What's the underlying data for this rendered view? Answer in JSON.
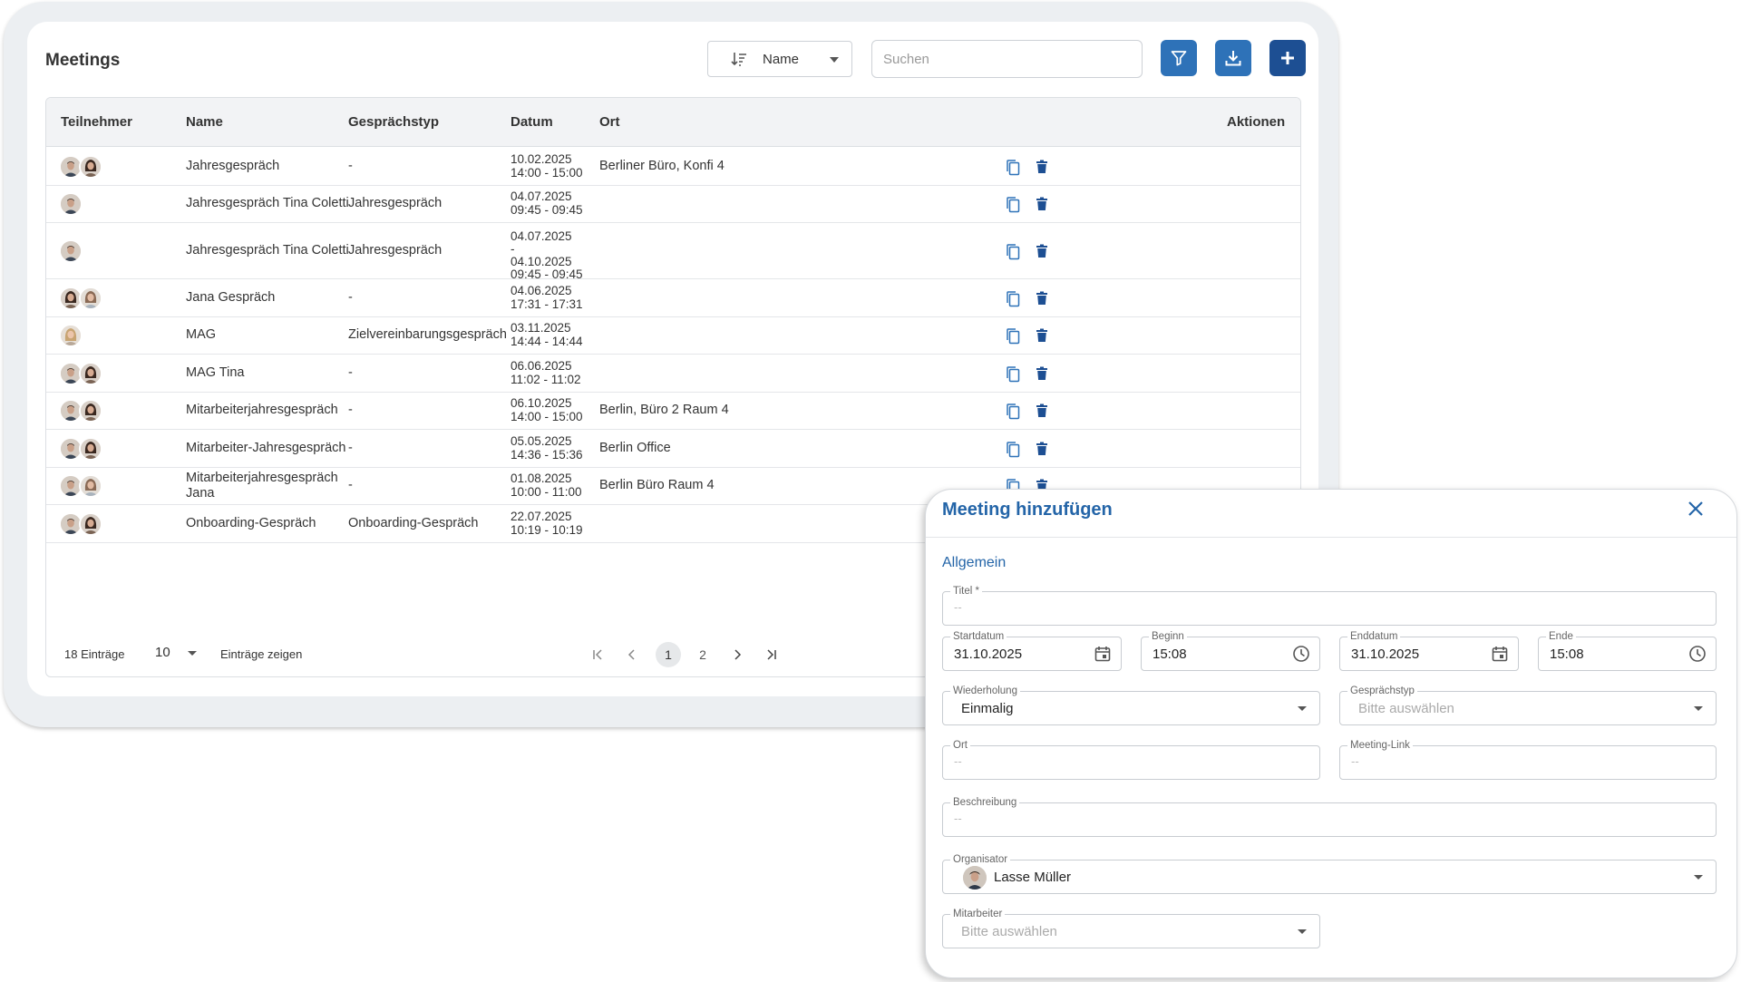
{
  "meetings": {
    "title": "Meetings",
    "sort": {
      "label": "Name",
      "icon": "sort-ascending-icon"
    },
    "search": {
      "placeholder": "Suchen",
      "value": ""
    },
    "toolbar": {
      "filter_icon": "filter-icon",
      "download_icon": "download-icon",
      "add_icon": "plus-icon"
    },
    "colors": {
      "primary": "#2e72b8",
      "primary_dark": "#1d4f93",
      "header_bg": "#f2f3f5"
    },
    "columns": {
      "participants": "Teilnehmer",
      "name": "Name",
      "type": "Gesprächstyp",
      "date": "Datum",
      "location": "Ort",
      "actions": "Aktionen"
    },
    "rows": [
      {
        "participants": [
          "man",
          "woman-dark"
        ],
        "name": "Jahresgespräch",
        "type": "-",
        "date": "10.02.2025",
        "time": "14:00 - 15:00",
        "location": "Berliner Büro, Konfi 4"
      },
      {
        "participants": [
          "man"
        ],
        "name": "Jahresgespräch Tina Coletti",
        "type": "Jahresgespräch",
        "date": "04.07.2025",
        "time": "09:45 - 09:45",
        "location": ""
      },
      {
        "participants": [
          "man"
        ],
        "name": "Jahresgespräch Tina Coletti",
        "type": "Jahresgespräch",
        "date": "04.07.2025",
        "date_sep": "-",
        "date_end": "04.10.2025",
        "time": "09:45 - 09:45",
        "location": ""
      },
      {
        "participants": [
          "woman-dark",
          "woman-light"
        ],
        "name": "Jana Gespräch",
        "type": "-",
        "date": "04.06.2025",
        "time": "17:31 - 17:31",
        "location": ""
      },
      {
        "participants": [
          "woman-blonde"
        ],
        "name": "MAG",
        "type": "Zielvereinbarungsgespräch",
        "date": "03.11.2025",
        "time": "14:44 - 14:44",
        "location": ""
      },
      {
        "participants": [
          "man",
          "woman-dark"
        ],
        "name": "MAG Tina",
        "type": "-",
        "date": "06.06.2025",
        "time": "11:02 - 11:02",
        "location": ""
      },
      {
        "participants": [
          "man",
          "woman-dark"
        ],
        "name": "Mitarbeiterjahresgespräch",
        "type": "-",
        "date": "06.10.2025",
        "time": "14:00 - 15:00",
        "location": "Berlin, Büro 2 Raum 4"
      },
      {
        "participants": [
          "man",
          "woman-dark"
        ],
        "name": "Mitarbeiter-Jahresgespräch",
        "type": "-",
        "date": "05.05.2025",
        "time": "14:36 - 15:36",
        "location": "Berlin Office"
      },
      {
        "participants": [
          "man",
          "woman-light"
        ],
        "name": "Mitarbeiterjahresgespräch",
        "name2": "Jana",
        "type": "-",
        "date": "01.08.2025",
        "time": "10:00 - 11:00",
        "location": "Berlin Büro Raum 4"
      },
      {
        "participants": [
          "man",
          "woman-dark"
        ],
        "name": "Onboarding-Gespräch",
        "type": "Onboarding-Gespräch",
        "date": "22.07.2025",
        "time": "10:19 - 10:19",
        "location": ""
      }
    ],
    "footer": {
      "total": "18 Einträge",
      "page_size": "10",
      "page_size_label": "Einträge zeigen",
      "pages": [
        "1",
        "2"
      ],
      "current_page": "1",
      "first_icon": "first-page-icon",
      "prev_icon": "chevron-left-icon",
      "next_icon": "chevron-right-icon",
      "last_icon": "last-page-icon"
    }
  },
  "modal": {
    "title": "Meeting hinzufügen",
    "close_icon": "close-icon",
    "tab": "Allgemein",
    "fields": {
      "title": {
        "label": "Titel *",
        "placeholder": "--"
      },
      "start_date": {
        "label": "Startdatum",
        "value": "31.10.2025",
        "icon": "calendar-icon"
      },
      "start_time": {
        "label": "Beginn",
        "value": "15:08",
        "icon": "clock-icon"
      },
      "end_date": {
        "label": "Enddatum",
        "value": "31.10.2025",
        "icon": "calendar-icon"
      },
      "end_time": {
        "label": "Ende",
        "value": "15:08",
        "icon": "clock-icon"
      },
      "recurrence": {
        "label": "Wiederholung",
        "value": "Einmalig"
      },
      "meeting_type": {
        "label": "Gesprächstyp",
        "placeholder": "Bitte auswählen"
      },
      "location": {
        "label": "Ort",
        "placeholder": "--"
      },
      "meeting_link": {
        "label": "Meeting-Link",
        "placeholder": "--"
      },
      "description": {
        "label": "Beschreibung",
        "placeholder": "--"
      },
      "organizer": {
        "label": "Organisator",
        "value": "Lasse Müller"
      },
      "employees": {
        "label": "Mitarbeiter",
        "placeholder": "Bitte auswählen"
      }
    }
  }
}
